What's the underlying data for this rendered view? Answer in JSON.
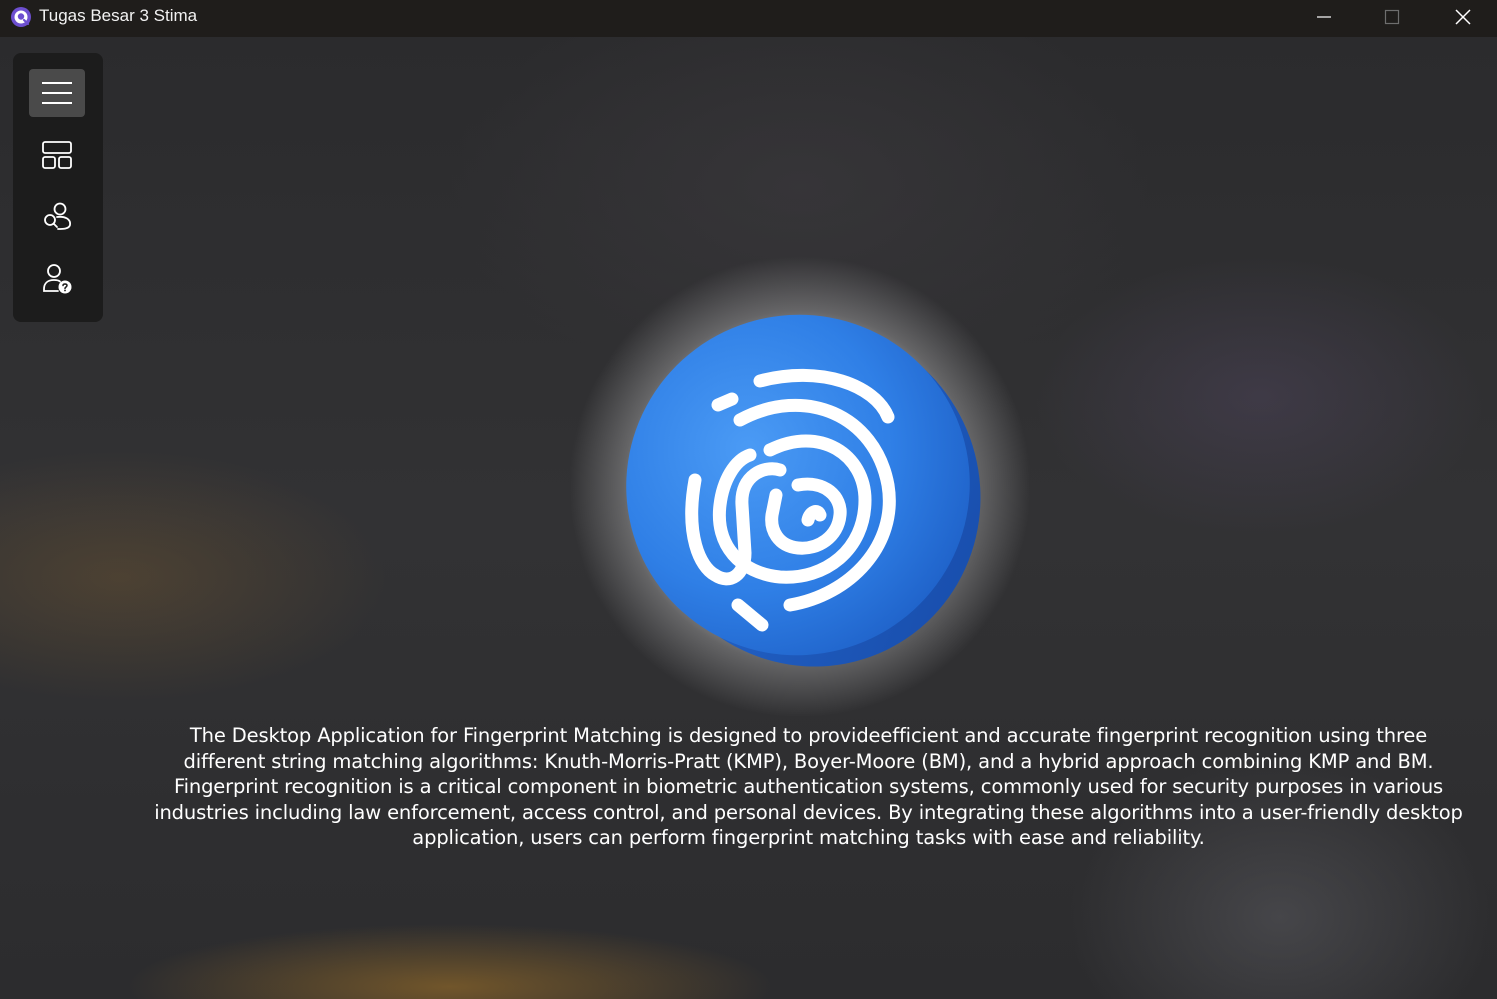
{
  "window": {
    "title": "Tugas Besar 3 Stima",
    "controls": [
      "minimize-icon",
      "maximize-icon",
      "close-icon"
    ]
  },
  "sidebar": {
    "items": [
      {
        "icon": "hamburger-menu-icon",
        "active": true
      },
      {
        "icon": "dashboard-layout-icon",
        "active": false
      },
      {
        "icon": "people-search-icon",
        "active": false
      },
      {
        "icon": "person-help-icon",
        "active": false
      }
    ]
  },
  "hero": {
    "icon": "fingerprint-icon"
  },
  "description": {
    "text": "The Desktop Application for Fingerprint Matching is designed to provideefficient and accurate fingerprint recognition using three different string matching algorithms: Knuth-Morris-Pratt (KMP), Boyer-Moore (BM), and a hybrid approach combining KMP and BM. Fingerprint recognition is a critical component in biometric authentication systems, commonly used for security purposes in various industries including law enforcement, access control, and personal devices. By integrating these algorithms into a user-friendly desktop application, users can perform fingerprint matching tasks with ease and reliability."
  },
  "colors": {
    "titlebar": "#1f1d1b",
    "sidebar": "#1c1c1c",
    "active_item": "#4a4a4a",
    "accent_blue": "#2f7fe6",
    "app_icon_purple": "#7b5cd6"
  }
}
